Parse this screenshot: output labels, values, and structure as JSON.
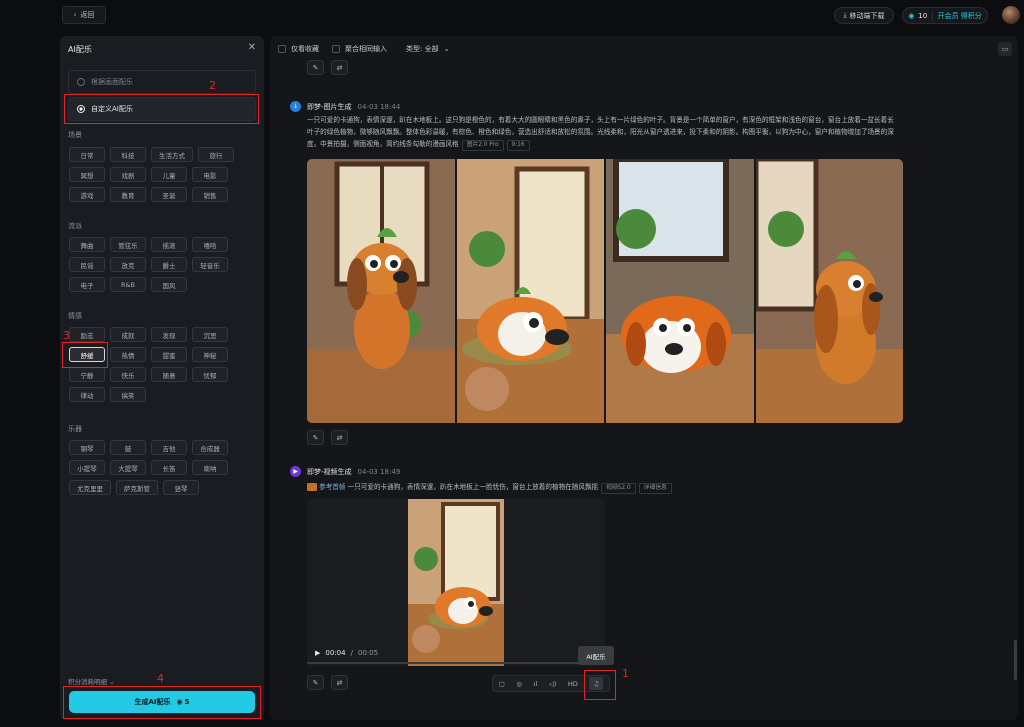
{
  "topbar": {
    "back_label": "返回",
    "mobile_download": "移动端下载",
    "credits_count": "10",
    "vip_label": "开会员 得积分"
  },
  "left_panel": {
    "title": "AI配乐",
    "options": [
      {
        "label": "根据画面配乐",
        "selected": false
      },
      {
        "label": "自定义AI配乐",
        "selected": true
      }
    ],
    "sections": [
      {
        "title": "场景",
        "tags": [
          "日常",
          "科技",
          "生活方式",
          "旅行",
          "冥想",
          "戏剧",
          "儿童",
          "电影",
          "游戏",
          "教育",
          "圣诞",
          "销售"
        ]
      },
      {
        "title": "流派",
        "tags": [
          "舞曲",
          "管弦乐",
          "摇滚",
          "嘻哈",
          "民谣",
          "放克",
          "爵士",
          "轻音乐",
          "电子",
          "R&B",
          "国风"
        ]
      },
      {
        "title": "情感",
        "tags": [
          "励志",
          "成就",
          "发现",
          "沉思",
          "舒缓",
          "热情",
          "甜蜜",
          "神秘",
          "宁静",
          "快乐",
          "随意",
          "忧郁",
          "律动",
          "搞笑"
        ],
        "selected": "舒缓"
      },
      {
        "title": "乐器",
        "tags": [
          "钢琴",
          "鼓",
          "吉他",
          "合成器",
          "小提琴",
          "大提琴",
          "长笛",
          "唢呐",
          "尤克里里",
          "萨克斯管",
          "竖琴"
        ]
      }
    ],
    "cost_note": "积分消耗明细",
    "generate_label": "生成AI配乐",
    "generate_cost": "5"
  },
  "filters": {
    "favorites_only": "仅看收藏",
    "merge_inputs": "聚合相同输入",
    "type_label": "类型: 全部"
  },
  "messages": [
    {
      "author": "即梦-图片生成",
      "time": "04-03 18:44",
      "prompt": "一只可爱的卡通狗，表情深邃，趴在木地板上。这只狗是橙色的，有着大大的圆眼睛和黑色的鼻子，头上有一片绿色的叶子。背景是一个简单的窗户，有深色的框架和浅色的窗台，窗台上放着一盆长着长叶子的绿色植物，微够随风飘飘。整体色彩温暖，有棕色、橙色和绿色，营造出舒适和放松的氛围。光线柔和，阳光从窗户透进来，投下柔和的阴影。构图平衡，以狗为中心，窗户和植物增加了场景的深度。中景拍摄，侧面视角，简约线条勾勒的漫画风格",
      "chips": [
        "图片2.0 Pro",
        "9:16"
      ]
    },
    {
      "author": "即梦-视频生成",
      "time": "04-03 18:49",
      "ref_label": "参考首帧",
      "prompt": "一只可爱的卡通狗，表情深邃，趴在木地板上一脸忧伤，窗台上放着的植物在随风飘摇",
      "chips": [
        "视频S2.0",
        "详细信息"
      ]
    }
  ],
  "video": {
    "current": "00:04",
    "total": "00:05"
  },
  "toolbar": {
    "hd_label": "HD",
    "tooltip": "AI配乐"
  },
  "annotations": [
    "1",
    "2",
    "3",
    "4"
  ],
  "colors": {
    "accent": "#22cbe3",
    "annotation": "#e0252a"
  }
}
